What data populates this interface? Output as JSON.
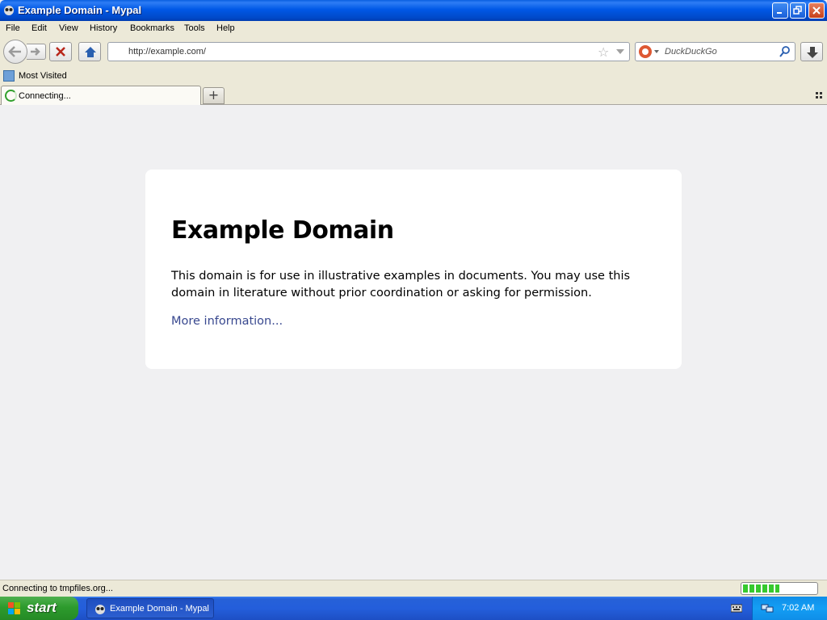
{
  "window": {
    "title": "Example Domain - Mypal"
  },
  "menu": {
    "items": [
      "File",
      "Edit",
      "View",
      "History",
      "Bookmarks",
      "Tools",
      "Help"
    ]
  },
  "toolbar": {
    "url": "http://example.com/",
    "search_placeholder": "DuckDuckGo"
  },
  "bookmarks": {
    "most_visited": "Most Visited"
  },
  "tabs": [
    {
      "label": "Connecting..."
    }
  ],
  "page": {
    "heading": "Example Domain",
    "paragraph": "This domain is for use in illustrative examples in documents. You may use this domain in literature without prior coordination or asking for permission.",
    "link": "More information..."
  },
  "status": {
    "text": "Connecting to tmpfiles.org...",
    "progress": 0.5
  },
  "taskbar": {
    "start_label": "start",
    "task_label": "Example Domain - Mypal",
    "clock": "7:02 AM"
  },
  "colors": {
    "link": "#38488f",
    "progress": "#36c92e",
    "title_bar": "#0058e6"
  }
}
